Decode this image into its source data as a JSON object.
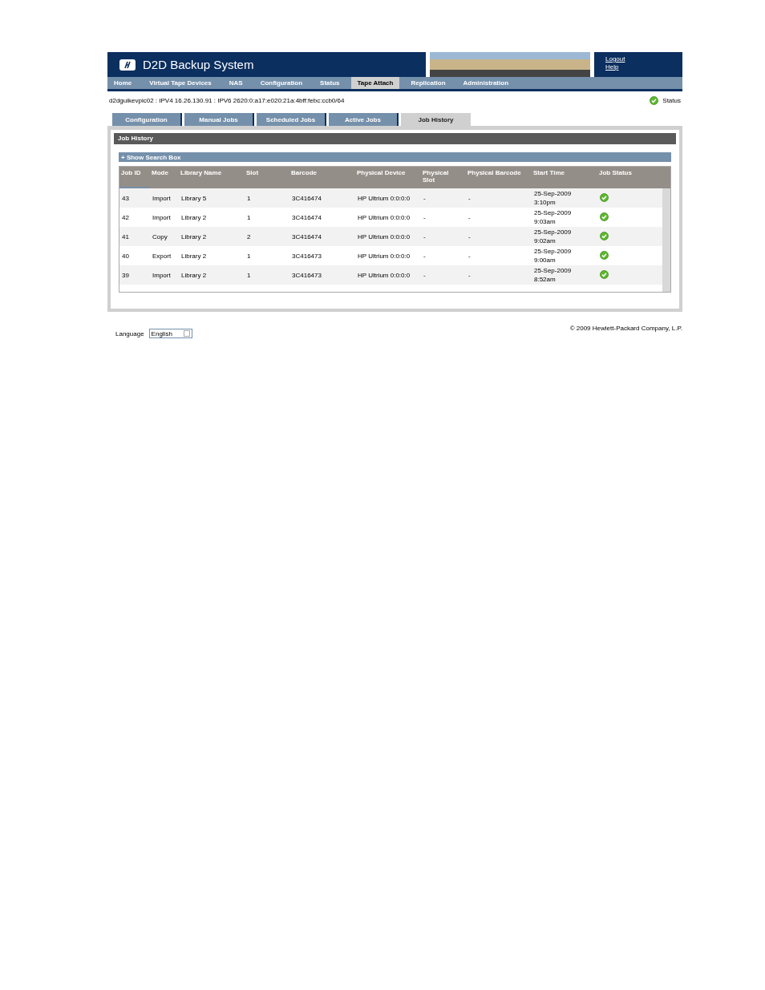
{
  "header": {
    "title": "D2D Backup System",
    "links": [
      "Logout",
      "Help"
    ]
  },
  "nav": [
    {
      "label": "Home",
      "selected": false
    },
    {
      "label": "Virtual Tape Devices",
      "selected": false
    },
    {
      "label": "NAS",
      "selected": false
    },
    {
      "label": "Configuration",
      "selected": false
    },
    {
      "label": "Status",
      "selected": false
    },
    {
      "label": "Tape Attach",
      "selected": true
    },
    {
      "label": "Replication",
      "selected": false
    },
    {
      "label": "Administration",
      "selected": false
    }
  ],
  "info_line": "d2dguikevpic02 : IPV4 16.26.130.91 : IPV6 2620:0:a17:e020:21a:4bff:febc:ccb0/64",
  "system_status": {
    "label": "Status",
    "ok": true
  },
  "tabs": [
    {
      "label": "Configuration",
      "selected": false
    },
    {
      "label": "Manual Jobs",
      "selected": false
    },
    {
      "label": "Scheduled Jobs",
      "selected": false
    },
    {
      "label": "Active Jobs",
      "selected": false
    },
    {
      "label": "Job History",
      "selected": true
    }
  ],
  "panel": {
    "title": "Job History",
    "search_toggle": "+ Show Search Box"
  },
  "table": {
    "columns": [
      {
        "label": "Job ID",
        "sorted": true
      },
      {
        "label": "Mode",
        "sorted": false
      },
      {
        "label": "Library Name",
        "sorted": false
      },
      {
        "label": "Slot",
        "sorted": false
      },
      {
        "label": "Barcode",
        "sorted": false
      },
      {
        "label": "Physical Device",
        "sorted": false
      },
      {
        "label": "Physical Slot",
        "sorted": false
      },
      {
        "label": "Physical Barcode",
        "sorted": false
      },
      {
        "label": "Start Time",
        "sorted": false
      },
      {
        "label": "Job Status",
        "sorted": false
      }
    ],
    "rows": [
      {
        "cells": [
          "43",
          "Import",
          "Library 5",
          "1",
          "3C416474",
          "HP Ultrium 0:0:0:0",
          "-",
          "-",
          "25-Sep-2009 3:10pm"
        ],
        "ok": true
      },
      {
        "cells": [
          "42",
          "Import",
          "Library 2",
          "1",
          "3C416474",
          "HP Ultrium 0:0:0:0",
          "-",
          "-",
          "25-Sep-2009 9:03am"
        ],
        "ok": true
      },
      {
        "cells": [
          "41",
          "Copy",
          "Library 2",
          "2",
          "3C416474",
          "HP Ultrium 0:0:0:0",
          "-",
          "-",
          "25-Sep-2009 9:02am"
        ],
        "ok": true
      },
      {
        "cells": [
          "40",
          "Export",
          "Library 2",
          "1",
          "3C416473",
          "HP Ultrium 0:0:0:0",
          "-",
          "-",
          "25-Sep-2009 9:00am"
        ],
        "ok": true
      },
      {
        "cells": [
          "39",
          "Import",
          "Library 2",
          "1",
          "3C416473",
          "HP Ultrium 0:0:0:0",
          "-",
          "-",
          "25-Sep-2009 8:52am"
        ],
        "ok": true
      }
    ]
  },
  "footer": {
    "language_label": "Language",
    "language_value": "English",
    "copyright": "© 2009 Hewlett-Packard Company, L.P."
  }
}
